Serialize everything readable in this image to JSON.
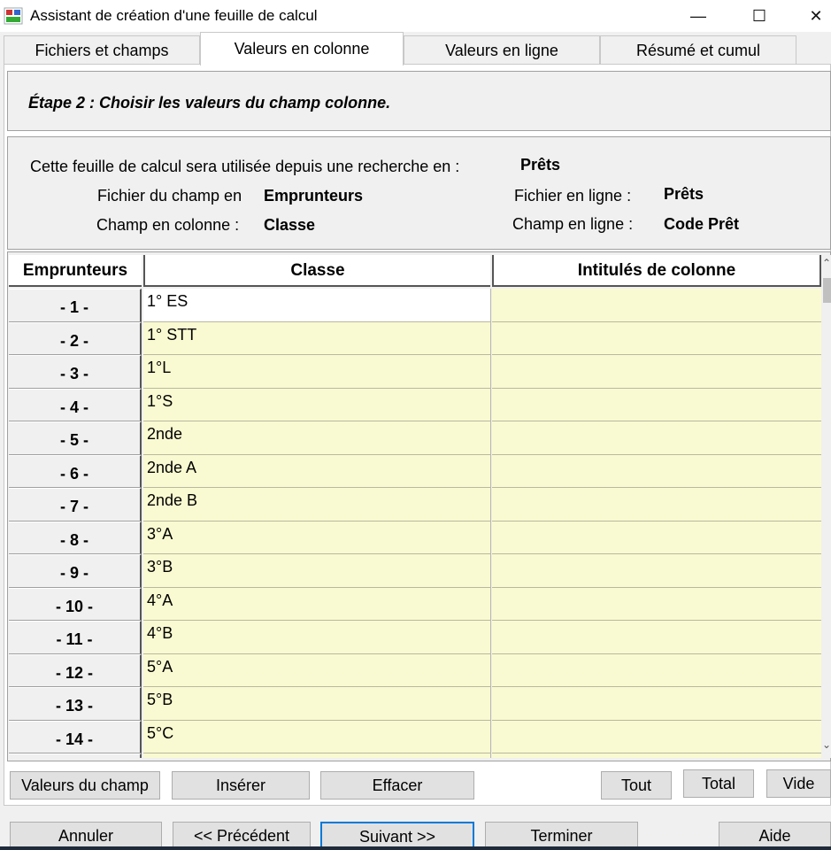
{
  "window": {
    "title": "Assistant de création d'une feuille de calcul",
    "min_glyph": "—",
    "max_glyph": "☐",
    "close_glyph": "✕"
  },
  "tabs": [
    {
      "label": "Fichiers et champs",
      "active": false
    },
    {
      "label": "Valeurs en colonne",
      "active": true
    },
    {
      "label": "Valeurs en ligne",
      "active": false
    },
    {
      "label": "Résumé et cumul",
      "active": false
    }
  ],
  "step": {
    "title": "Étape 2 :  Choisir les valeurs du champ colonne."
  },
  "info": {
    "search_label": "Cette feuille de calcul sera utilisée depuis une recherche en :",
    "search_value": "Prêts",
    "file_col_label": "Fichier du champ en",
    "file_col_value": "Emprunteurs",
    "col_field_label": "Champ en colonne :",
    "col_field_value": "Classe",
    "file_row_label": "Fichier en ligne :",
    "file_row_value": "Prêts",
    "row_field_label": "Champ en ligne :",
    "row_field_value": "Code Prêt"
  },
  "grid": {
    "headers": {
      "row": "Emprunteurs",
      "classe": "Classe",
      "intitules": "Intitulés de colonne"
    },
    "rows": [
      {
        "num": "- 1 -",
        "classe": "1° ES"
      },
      {
        "num": "- 2 -",
        "classe": "1° STT"
      },
      {
        "num": "- 3 -",
        "classe": "1°L"
      },
      {
        "num": "- 4 -",
        "classe": "1°S"
      },
      {
        "num": "- 5 -",
        "classe": "2nde"
      },
      {
        "num": "- 6 -",
        "classe": "2nde A"
      },
      {
        "num": "- 7 -",
        "classe": "2nde B"
      },
      {
        "num": "- 8 -",
        "classe": "3°A"
      },
      {
        "num": "- 9 -",
        "classe": "3°B"
      },
      {
        "num": "- 10 -",
        "classe": "4°A"
      },
      {
        "num": "- 11 -",
        "classe": "4°B"
      },
      {
        "num": "- 12 -",
        "classe": "5°A"
      },
      {
        "num": "- 13 -",
        "classe": "5°B"
      },
      {
        "num": "- 14 -",
        "classe": "5°C"
      }
    ]
  },
  "actions": {
    "valeurs": "Valeurs du champ",
    "inserer": "Insérer",
    "effacer": "Effacer",
    "tout": "Tout",
    "total": "Total",
    "vide": "Vide"
  },
  "nav": {
    "annuler": "Annuler",
    "precedent": "<< Précédent",
    "suivant": "Suivant >>",
    "terminer": "Terminer",
    "aide": "Aide"
  },
  "colors": {
    "cell_fill": "#fafad2",
    "accent_border": "#0078d7"
  }
}
